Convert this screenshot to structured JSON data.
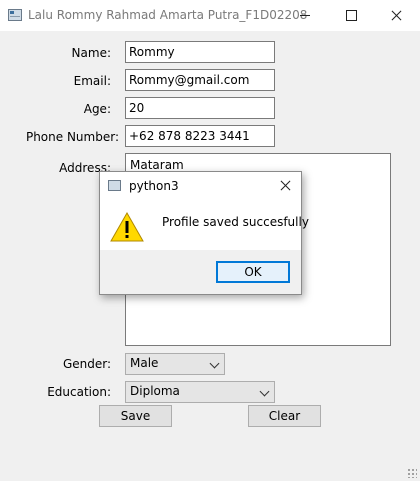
{
  "window": {
    "title": "Lalu Rommy Rahmad Amarta Putra_F1D02208"
  },
  "form": {
    "name_label": "Name:",
    "name_value": "Rommy",
    "email_label": "Email:",
    "email_value": "Rommy@gmail.com",
    "age_label": "Age:",
    "age_value": "20",
    "phone_label": "Phone Number:",
    "phone_value": "+62 878 8223 3441",
    "address_label": "Address:",
    "address_value": "Mataram",
    "gender_label": "Gender:",
    "gender_value": "Male",
    "education_label": "Education:",
    "education_value": "Diploma",
    "save_label": "Save",
    "clear_label": "Clear"
  },
  "dialog": {
    "title": "python3",
    "message": "Profile saved succesfully",
    "ok_label": "OK",
    "icon": "warning-icon",
    "warning_color": "#ffd800"
  }
}
